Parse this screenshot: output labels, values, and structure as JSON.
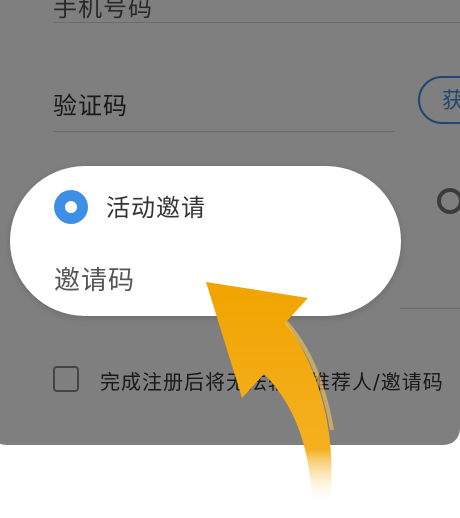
{
  "form": {
    "top_field_label": "手机号码",
    "verification_label": "验证码",
    "get_code_label": "获取验证码",
    "activity_invite_label": "活动邀请",
    "invite_code_label": "邀请码",
    "agreement_text": "完成注册后将无法输入推荐人/邀请码"
  },
  "icons": {
    "radio_selected": "radio-selected-icon",
    "radio_unselected": "radio-unselected-icon",
    "checkbox": "checkbox-icon",
    "pointer": "curved-arrow-icon"
  },
  "colors": {
    "accent": "#3d8fe6",
    "arrow": "#f2a60c",
    "overlay": "rgba(0,0,0,0.5)"
  }
}
